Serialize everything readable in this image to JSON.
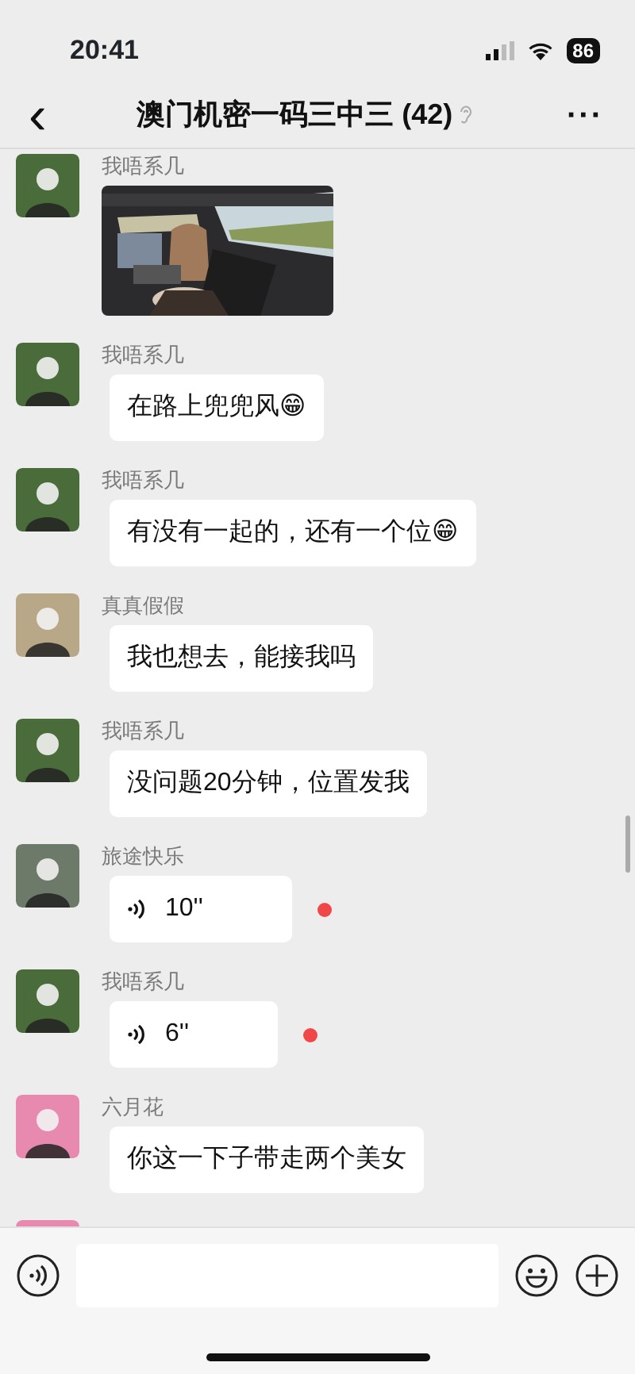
{
  "status_bar": {
    "time": "20:41",
    "battery": "86"
  },
  "header": {
    "back": "‹",
    "title": "澳门机密一码三中三 (42)",
    "more": "···"
  },
  "messages": [
    {
      "sender": "我唔系几",
      "color": "#4a6b3a"
    },
    {
      "sender": "我唔系几",
      "color": "#4a6b3a",
      "kind": "text",
      "text": "在路上兜兜风😁"
    },
    {
      "sender": "我唔系几",
      "color": "#4a6b3a",
      "kind": "text",
      "text": "有没有一起的，还有一个位😁"
    },
    {
      "sender": "真真假假",
      "color": "#b8a888",
      "kind": "text",
      "text": "我也想去，能接我吗"
    },
    {
      "sender": "我唔系几",
      "color": "#4a6b3a",
      "kind": "text",
      "text": "没问题20分钟，位置发我"
    },
    {
      "sender": "旅途快乐",
      "color": "#6d7a6a",
      "kind": "voice",
      "duration": "10''",
      "unread": true
    },
    {
      "sender": "我唔系几",
      "color": "#4a6b3a",
      "kind": "voice",
      "duration": "6''",
      "unread": true
    },
    {
      "sender": "六月花",
      "color": "#e88ab0",
      "kind": "text",
      "text": "你这一下子带走两个美女"
    },
    {
      "color": "#e88ab0",
      "kind": "cut"
    }
  ]
}
